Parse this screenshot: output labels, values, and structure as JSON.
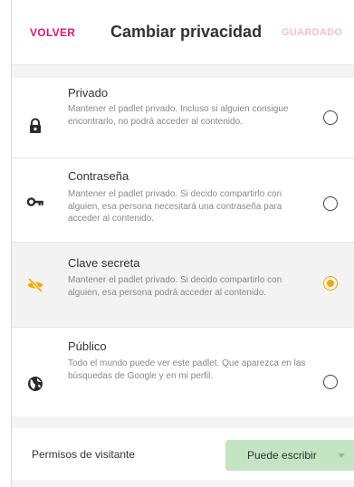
{
  "header": {
    "back_label": "VOLVER",
    "title": "Cambiar privacidad",
    "save_label": "GUARDADO"
  },
  "options": [
    {
      "title": "Privado",
      "description": "Mantener el padlet privado. Incluso si alguien consigue encontrarlo, no podrá acceder al contenido.",
      "icon": "lock-icon",
      "selected": false
    },
    {
      "title": "Contraseña",
      "description": "Mantener el padlet privado. Si decido compartirlo con alguien, esa persona necesitará una contraseña para acceder al contenido.",
      "icon": "key-icon",
      "selected": false
    },
    {
      "title": "Clave secreta",
      "description": "Mantener el padlet privado. Si decido compartirlo con alguien, esa persona podrá acceder al contenido.",
      "icon": "eye-off-icon",
      "selected": true
    },
    {
      "title": "Público",
      "description": "Todo el mundo puede ver este padlet. Que aparezca en las búsquedas de Google y en mi perfil.",
      "icon": "globe-icon",
      "selected": false
    }
  ],
  "permissions": {
    "label": "Permisos de visitante",
    "value": "Puede escribir"
  },
  "colors": {
    "accent": "#e0176b",
    "selected_radio": "#f5a800",
    "select_bg": "#c3e5c3"
  }
}
